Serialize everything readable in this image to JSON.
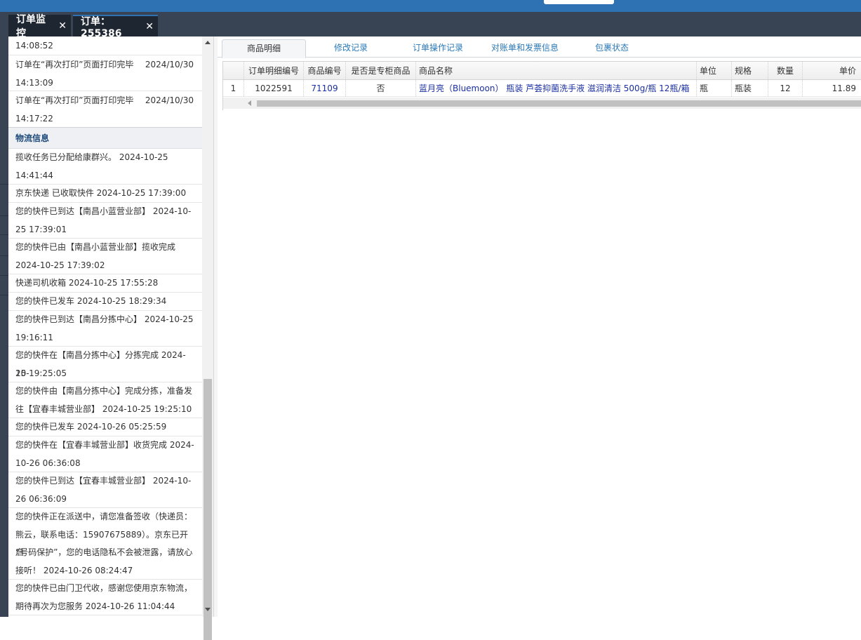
{
  "tabs": [
    {
      "label": "订单监控"
    },
    {
      "label": "订单：255386"
    }
  ],
  "close_glyph": "✕",
  "log_entries_top": [
    {
      "line1": "14:08:52",
      "line2": ""
    },
    {
      "line1": "订单在“再次打印”页面打印完毕",
      "date": "2024/10/30",
      "line2": "14:13:09"
    },
    {
      "line1": "订单在“再次打印”页面打印完毕",
      "date": "2024/10/30",
      "line2": "14:17:22"
    }
  ],
  "logistics": {
    "title": "物流信息",
    "entries": [
      [
        "揽收任务已分配给康群兴。 2024-10-25",
        "14:41:44"
      ],
      [
        "京东快递 已收取快件 2024-10-25 17:39:00"
      ],
      [
        "您的快件已到达【南昌小蓝营业部】 2024-10-",
        "25 17:39:01"
      ],
      [
        "您的快件已由【南昌小蓝营业部】揽收完成",
        "2024-10-25 17:39:02"
      ],
      [
        "快递司机收箱 2024-10-25 17:55:28"
      ],
      [
        "您的快件已发车 2024-10-25 18:29:34"
      ],
      [
        "您的快件已到达【南昌分拣中心】 2024-10-25",
        "19:16:11"
      ],
      [
        "您的快件在【南昌分拣中心】分拣完成 2024-10-",
        "25 19:25:05"
      ],
      [
        "您的快件由【南昌分拣中心】完成分拣，准备发",
        "往【宜春丰城营业部】 2024-10-25 19:25:10"
      ],
      [
        "您的快件已发车 2024-10-26 05:25:59"
      ],
      [
        "您的快件在【宜春丰城营业部】收货完成 2024-",
        "10-26 06:36:08"
      ],
      [
        "您的快件已到达【宜春丰城营业部】 2024-10-",
        "26 06:36:09"
      ],
      [
        "您的快件正在派送中，请您准备签收（快递员：",
        "熊云，联系电话：15907675889）。京东已开启",
        "“号码保护”，您的电话隐私不会被泄露，请放心",
        "接听！ 2024-10-26 08:24:47"
      ],
      [
        "您的快件已由门卫代收，感谢您使用京东物流，",
        "期待再次为您服务 2024-10-26 11:04:44"
      ]
    ]
  },
  "subtabs": [
    "商品明细",
    "修改记录",
    "订单操作记录",
    "对账单和发票信息",
    "包裹状态"
  ],
  "grid": {
    "headers": [
      "",
      "订单明细编号",
      "商品编号",
      "是否是专柜商品",
      "商品名称",
      "单位",
      "规格",
      "数量",
      "单价"
    ],
    "rows": [
      [
        "1",
        "1022591",
        "71109",
        "否",
        "蓝月亮（Bluemoon） 瓶装 芦荟抑菌洗手液 滋润清洁 500g/瓶 12瓶/箱",
        "瓶",
        "瓶装",
        "12",
        "11.89"
      ]
    ]
  },
  "colors": {
    "topbar": "#2f72b4",
    "tabstrip": "#384353",
    "link": "#1a2fa0"
  }
}
